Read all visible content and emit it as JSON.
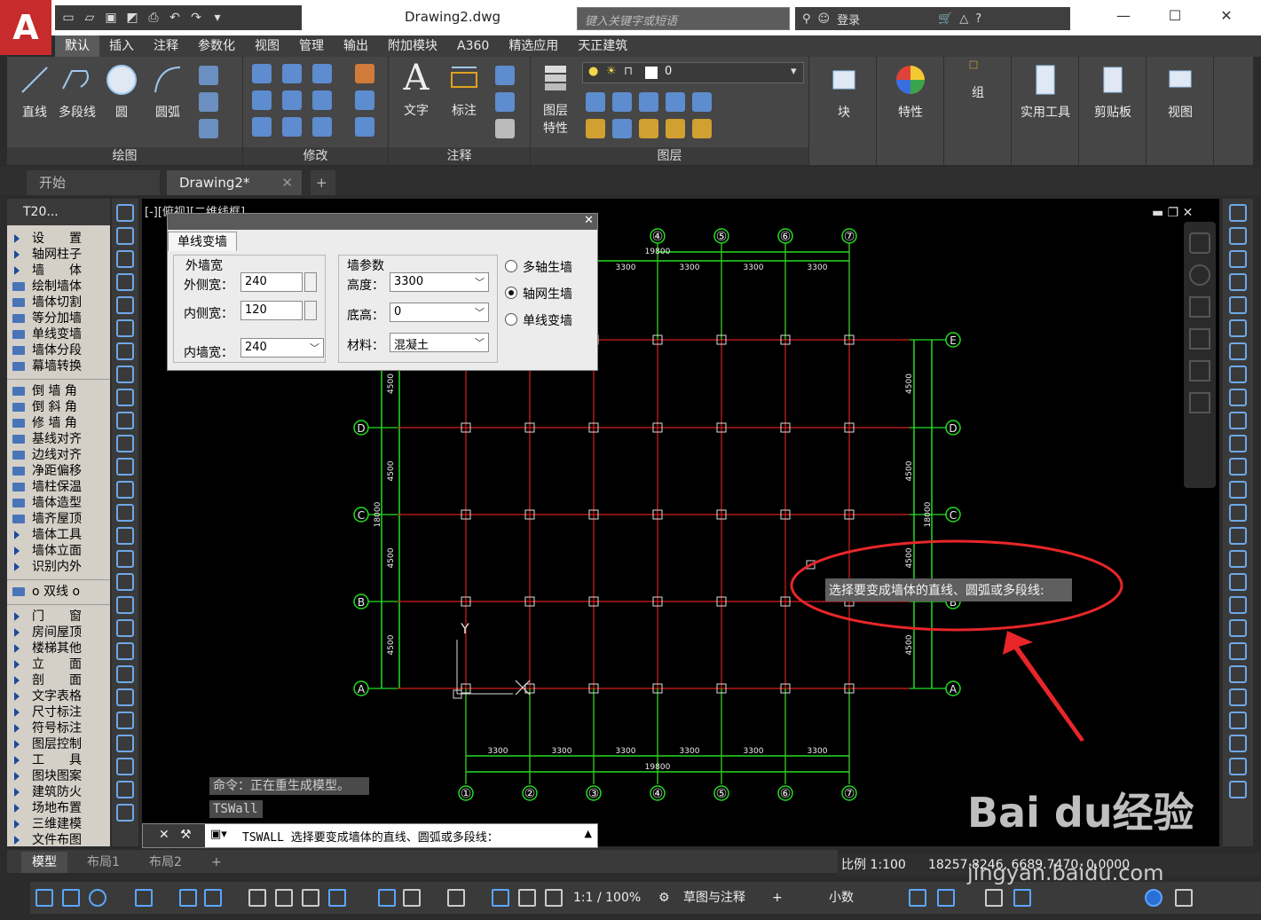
{
  "app": {
    "logo_letter": "A",
    "doc_title": "Drawing2.dwg",
    "search_placeholder": "键入关键字或短语",
    "login_label": "登录"
  },
  "ribbon": {
    "tabs": [
      "默认",
      "插入",
      "注释",
      "参数化",
      "视图",
      "管理",
      "输出",
      "附加模块",
      "A360",
      "精选应用",
      "天正建筑"
    ],
    "draw_buttons": [
      "直线",
      "多段线",
      "圆",
      "圆弧"
    ],
    "text_buttons": [
      "文字",
      "标注"
    ],
    "layer_props": [
      "图层",
      "特性"
    ],
    "layer_current": "0",
    "big_buttons": [
      "块",
      "特性",
      "组",
      "实用工具",
      "剪贴板",
      "视图"
    ],
    "group_labels": [
      "绘图",
      "修改",
      "注释",
      "图层"
    ]
  },
  "doc_tabs": [
    "开始",
    "Drawing2*"
  ],
  "left_panel": {
    "title": "T20...",
    "items": [
      {
        "label": "设　　置",
        "tri": true
      },
      {
        "label": "轴网柱子",
        "tri": true
      },
      {
        "label": "墙　　体",
        "tri": true
      },
      {
        "label": "绘制墙体"
      },
      {
        "label": "墙体切割"
      },
      {
        "label": "等分加墙"
      },
      {
        "label": "单线变墙"
      },
      {
        "label": "墙体分段"
      },
      {
        "label": "幕墙转换"
      },
      {
        "sep": true
      },
      {
        "label": "倒 墙 角"
      },
      {
        "label": "倒 斜 角"
      },
      {
        "label": "修 墙 角"
      },
      {
        "label": "基线对齐"
      },
      {
        "label": "边线对齐"
      },
      {
        "label": "净距偏移"
      },
      {
        "label": "墙柱保温"
      },
      {
        "label": "墙体造型"
      },
      {
        "label": "墙齐屋顶"
      },
      {
        "label": "墙体工具",
        "tri": true
      },
      {
        "label": "墙体立面",
        "tri": true
      },
      {
        "label": "识别内外",
        "tri": true
      },
      {
        "sep": true
      },
      {
        "label": "o 双线 o"
      },
      {
        "sep": true
      },
      {
        "label": "门　　窗",
        "tri": true
      },
      {
        "label": "房间屋顶",
        "tri": true
      },
      {
        "label": "楼梯其他",
        "tri": true
      },
      {
        "label": "立　　面",
        "tri": true
      },
      {
        "label": "剖　　面",
        "tri": true
      },
      {
        "label": "文字表格",
        "tri": true
      },
      {
        "label": "尺寸标注",
        "tri": true
      },
      {
        "label": "符号标注",
        "tri": true
      },
      {
        "label": "图层控制",
        "tri": true
      },
      {
        "label": "工　　具",
        "tri": true
      },
      {
        "label": "图块图案",
        "tri": true
      },
      {
        "label": "建筑防火",
        "tri": true
      },
      {
        "label": "场地布置",
        "tri": true
      },
      {
        "label": "三维建模",
        "tri": true
      },
      {
        "label": "文件布图",
        "tri": true
      }
    ]
  },
  "viewport": {
    "label": "[-][俯视][二维线框]",
    "top_axes": [
      "④",
      "⑤",
      "⑥",
      "⑦"
    ],
    "bottom_axes": [
      "①",
      "②",
      "③",
      "④",
      "⑤",
      "⑥",
      "⑦"
    ],
    "row_axes": [
      "E",
      "D",
      "C",
      "B",
      "A"
    ],
    "span_label": "3300",
    "total_label": "19800",
    "row_span_label": "4500",
    "total_height_label": "18000",
    "tooltip": "选择要变成墙体的直线、圆弧或多段线:",
    "ucs_y": "Y",
    "accent_red": "#e8262a",
    "grid_green": "#22dd22",
    "axis_red": "#d61f1f"
  },
  "dialog": {
    "tab": "单线变墙",
    "outer_group": "外墙宽",
    "outer_w_label": "外侧宽：",
    "outer_w": "240",
    "inner_w_label": "内侧宽：",
    "inner_w": "120",
    "inner_wall_label": "内墙宽：",
    "inner_wall": "240",
    "param_group": "墙参数",
    "height_label": "高度：",
    "height": "3300",
    "base_label": "底高：",
    "base": "0",
    "mat_label": "材料：",
    "mat": "混凝土",
    "radio1": "多轴生墙",
    "radio2": "轴网生墙",
    "radio3": "单线变墙",
    "radio_selected": 2
  },
  "command": {
    "history": "命令：正在重生成模型。",
    "echo": "TSWall",
    "prompt": "TSWALL 选择要变成墙体的直线、圆弧或多段线："
  },
  "layout_tabs": [
    "模型",
    "布局1",
    "布局2"
  ],
  "status": {
    "scale": "比例 1:100",
    "coords": "18257.8246, 6689.7470, 0.0000",
    "zoom": "1:1 / 100%",
    "workspace": "草图与注释",
    "units": "小数"
  },
  "watermark": {
    "brand": "Bai du经验",
    "url": "jingyan.baidu.com"
  }
}
